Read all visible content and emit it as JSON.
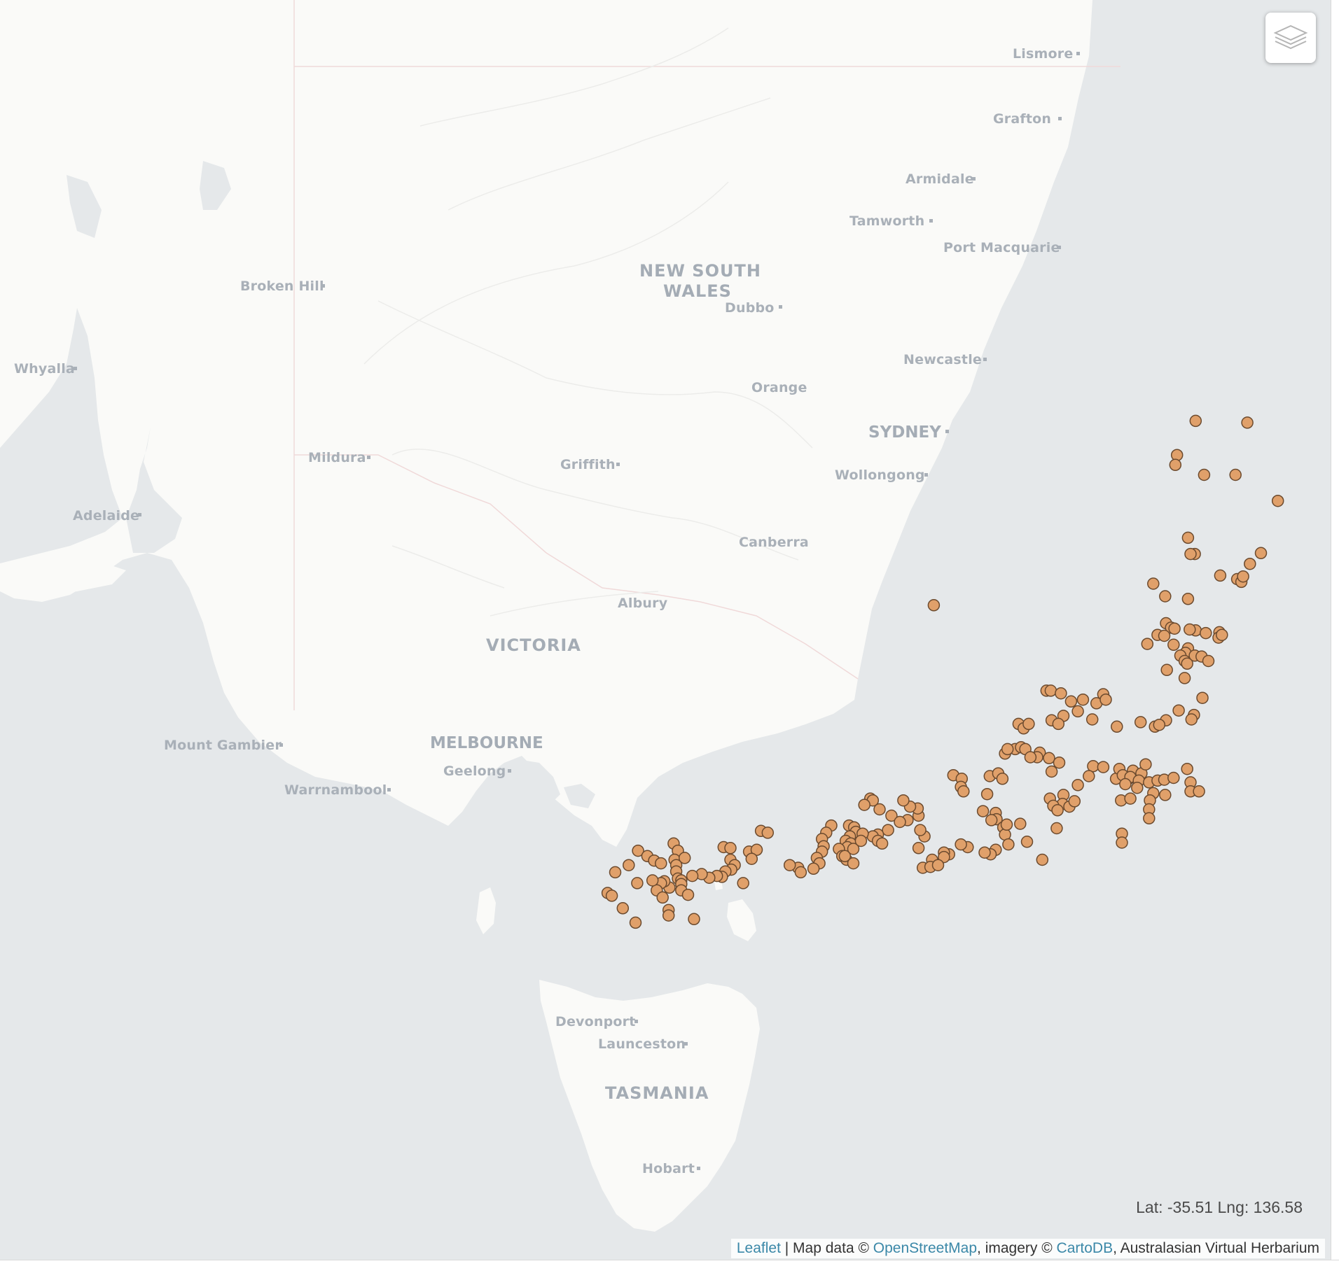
{
  "map": {
    "places": [
      {
        "name": "Lismore",
        "id": "lismore"
      },
      {
        "name": "Grafton",
        "id": "grafton"
      },
      {
        "name": "Armidale",
        "id": "armidale"
      },
      {
        "name": "Tamworth",
        "id": "tamworth"
      },
      {
        "name": "Port Macquarie",
        "id": "port-macquarie"
      },
      {
        "name": "Broken Hill",
        "id": "broken-hill"
      },
      {
        "name": "Dubbo",
        "id": "dubbo"
      },
      {
        "name": "Newcastle",
        "id": "newcastle"
      },
      {
        "name": "Whyalla",
        "id": "whyalla"
      },
      {
        "name": "Orange",
        "id": "orange"
      },
      {
        "name": "SYDNEY",
        "id": "sydney"
      },
      {
        "name": "Mildura",
        "id": "mildura"
      },
      {
        "name": "Griffith",
        "id": "griffith"
      },
      {
        "name": "Wollongong",
        "id": "wollongong"
      },
      {
        "name": "Adelaide",
        "id": "adelaide"
      },
      {
        "name": "Canberra",
        "id": "canberra"
      },
      {
        "name": "Albury",
        "id": "albury"
      },
      {
        "name": "Mount Gambier",
        "id": "mount-gambier"
      },
      {
        "name": "MELBOURNE",
        "id": "melbourne"
      },
      {
        "name": "Geelong",
        "id": "geelong"
      },
      {
        "name": "Warrnambool",
        "id": "warrnambool"
      },
      {
        "name": "Devonport",
        "id": "devonport"
      },
      {
        "name": "Launceston",
        "id": "launceston"
      },
      {
        "name": "Hobart",
        "id": "hobart"
      }
    ],
    "regions": [
      {
        "name": "NEW SOUTH",
        "id": "nsw-1"
      },
      {
        "name": "WALES",
        "id": "nsw-2"
      },
      {
        "name": "VICTORIA",
        "id": "victoria"
      },
      {
        "name": "TASMANIA",
        "id": "tasmania"
      }
    ],
    "marker_color": "#e0a06a",
    "marker_stroke": "#6b4a2e",
    "land_color": "#fafaf8",
    "water_color": "#e5e8ea",
    "occurrences": [
      [
        -31.42,
        152.78
      ],
      [
        -31.46,
        152.74
      ],
      [
        -31.5,
        152.7
      ],
      [
        -31.47,
        152.73
      ],
      [
        -32.98,
        150.69
      ],
      [
        -33.0,
        151.3
      ],
      [
        -33.36,
        150.47
      ],
      [
        -33.47,
        150.45
      ],
      [
        -33.58,
        150.79
      ],
      [
        -33.58,
        151.16
      ],
      [
        -33.87,
        151.66
      ],
      [
        -34.28,
        150.6
      ],
      [
        -34.46,
        150.68
      ],
      [
        -34.46,
        150.63
      ],
      [
        -34.45,
        151.46
      ],
      [
        -34.57,
        151.33
      ],
      [
        -34.7,
        150.98
      ],
      [
        -34.74,
        151.18
      ],
      [
        -34.77,
        151.23
      ],
      [
        -34.71,
        151.25
      ],
      [
        -34.79,
        150.19
      ],
      [
        -34.93,
        150.33
      ],
      [
        -35.03,
        147.6
      ],
      [
        -34.96,
        150.6
      ],
      [
        -35.23,
        150.34
      ],
      [
        -35.28,
        150.4
      ],
      [
        -35.29,
        150.44
      ],
      [
        -35.31,
        150.69
      ],
      [
        -35.34,
        150.81
      ],
      [
        -35.33,
        150.97
      ],
      [
        -35.39,
        150.96
      ],
      [
        -35.36,
        151.0
      ],
      [
        -35.36,
        150.24
      ],
      [
        -35.3,
        150.62
      ],
      [
        -35.37,
        150.32
      ],
      [
        -35.47,
        150.43
      ],
      [
        -35.46,
        150.12
      ],
      [
        -35.51,
        150.6
      ],
      [
        -35.56,
        150.57
      ],
      [
        -35.59,
        150.51
      ],
      [
        -35.59,
        150.68
      ],
      [
        -35.6,
        150.76
      ],
      [
        -35.65,
        150.84
      ],
      [
        -35.65,
        150.56
      ],
      [
        -35.68,
        150.59
      ],
      [
        -35.75,
        150.35
      ],
      [
        -35.84,
        150.56
      ],
      [
        -36.06,
        150.77
      ],
      [
        -36.2,
        150.49
      ],
      [
        -36.25,
        150.67
      ],
      [
        -36.31,
        150.34
      ],
      [
        -36.3,
        150.64
      ],
      [
        -36.38,
        150.21
      ],
      [
        -36.36,
        150.26
      ],
      [
        -36.33,
        150.04
      ],
      [
        -35.98,
        148.93
      ],
      [
        -35.98,
        148.98
      ],
      [
        -36.01,
        149.1
      ],
      [
        -36.1,
        149.22
      ],
      [
        -36.08,
        149.36
      ],
      [
        -36.12,
        149.52
      ],
      [
        -36.02,
        149.6
      ],
      [
        -36.08,
        149.63
      ],
      [
        -36.21,
        149.3
      ],
      [
        -36.26,
        149.13
      ],
      [
        -36.31,
        148.99
      ],
      [
        -36.35,
        149.07
      ],
      [
        -36.3,
        149.47
      ],
      [
        -36.38,
        149.76
      ],
      [
        -36.35,
        148.6
      ],
      [
        -36.4,
        148.66
      ],
      [
        -36.35,
        148.72
      ],
      [
        -36.63,
        148.56
      ],
      [
        -36.61,
        148.63
      ],
      [
        -36.63,
        148.68
      ],
      [
        -36.67,
        148.85
      ],
      [
        -36.72,
        148.82
      ],
      [
        -36.72,
        148.74
      ],
      [
        -36.68,
        148.44
      ],
      [
        -36.63,
        148.47
      ],
      [
        -36.73,
        148.96
      ],
      [
        -36.78,
        149.08
      ],
      [
        -36.88,
        148.99
      ],
      [
        -36.82,
        149.48
      ],
      [
        -36.83,
        149.6
      ],
      [
        -36.96,
        149.75
      ],
      [
        -36.87,
        149.95
      ],
      [
        -36.96,
        149.9
      ],
      [
        -36.9,
        150.05
      ],
      [
        -36.8,
        150.1
      ],
      [
        -36.85,
        149.79
      ],
      [
        -36.92,
        149.83
      ],
      [
        -36.94,
        149.92
      ],
      [
        -36.98,
        150.02
      ],
      [
        -37.0,
        150.14
      ],
      [
        -36.98,
        150.24
      ],
      [
        -36.97,
        150.32
      ],
      [
        -36.95,
        150.43
      ],
      [
        -36.85,
        150.59
      ],
      [
        -37.0,
        150.63
      ],
      [
        -37.1,
        150.63
      ],
      [
        -37.1,
        150.73
      ],
      [
        -37.14,
        150.33
      ],
      [
        -37.12,
        150.19
      ],
      [
        -37.06,
        150.0
      ],
      [
        -37.02,
        149.86
      ],
      [
        -37.2,
        149.81
      ],
      [
        -37.18,
        149.92
      ],
      [
        -37.2,
        150.15
      ],
      [
        -37.3,
        150.14
      ],
      [
        -37.4,
        150.14
      ],
      [
        -37.57,
        149.82
      ],
      [
        -37.67,
        149.82
      ],
      [
        -36.93,
        149.43
      ],
      [
        -37.03,
        149.3
      ],
      [
        -37.14,
        149.13
      ],
      [
        -37.24,
        149.12
      ],
      [
        -37.27,
        149.2
      ],
      [
        -37.21,
        149.26
      ],
      [
        -37.18,
        148.97
      ],
      [
        -37.26,
        149.01
      ],
      [
        -37.31,
        149.06
      ],
      [
        -37.51,
        149.05
      ],
      [
        -37.86,
        148.88
      ],
      [
        -36.93,
        148.26
      ],
      [
        -36.9,
        148.36
      ],
      [
        -36.96,
        148.41
      ],
      [
        -36.92,
        147.83
      ],
      [
        -36.96,
        147.93
      ],
      [
        -37.05,
        147.92
      ],
      [
        -37.1,
        147.95
      ],
      [
        -37.13,
        148.23
      ],
      [
        -37.32,
        148.18
      ],
      [
        -37.34,
        148.33
      ],
      [
        -37.41,
        148.34
      ],
      [
        -37.42,
        148.28
      ],
      [
        -37.5,
        148.42
      ],
      [
        -37.58,
        148.44
      ],
      [
        -37.47,
        148.46
      ],
      [
        -37.46,
        148.62
      ],
      [
        -37.66,
        148.7
      ],
      [
        -37.69,
        148.48
      ],
      [
        -37.75,
        148.33
      ],
      [
        -37.8,
        148.27
      ],
      [
        -37.78,
        148.2
      ],
      [
        -37.72,
        148.0
      ],
      [
        -37.69,
        147.92
      ],
      [
        -37.8,
        147.78
      ],
      [
        -37.78,
        147.72
      ],
      [
        -37.83,
        147.72
      ],
      [
        -37.86,
        147.58
      ],
      [
        -37.95,
        147.47
      ],
      [
        -37.94,
        147.56
      ],
      [
        -37.92,
        147.65
      ],
      [
        -37.73,
        147.42
      ],
      [
        -37.6,
        147.49
      ],
      [
        -37.53,
        147.44
      ],
      [
        -37.42,
        147.29
      ],
      [
        -37.37,
        147.42
      ],
      [
        -37.29,
        147.41
      ],
      [
        -37.27,
        147.32
      ],
      [
        -37.2,
        147.24
      ],
      [
        -37.18,
        146.85
      ],
      [
        -37.2,
        146.88
      ],
      [
        -37.25,
        146.78
      ],
      [
        -37.3,
        146.96
      ],
      [
        -37.37,
        147.1
      ],
      [
        -37.44,
        147.2
      ],
      [
        -37.53,
        147.06
      ],
      [
        -37.58,
        146.94
      ],
      [
        -37.6,
        146.88
      ],
      [
        -37.65,
        146.94
      ],
      [
        -37.68,
        146.99
      ],
      [
        -37.48,
        146.6
      ],
      [
        -37.5,
        146.66
      ],
      [
        -37.55,
        146.68
      ],
      [
        -37.57,
        146.76
      ],
      [
        -37.6,
        146.61
      ],
      [
        -37.65,
        146.56
      ],
      [
        -37.68,
        146.62
      ],
      [
        -37.72,
        146.58
      ],
      [
        -37.74,
        146.48
      ],
      [
        -37.82,
        146.52
      ],
      [
        -37.86,
        146.57
      ],
      [
        -37.48,
        146.39
      ],
      [
        -37.56,
        146.33
      ],
      [
        -37.63,
        146.28
      ],
      [
        -37.71,
        146.3
      ],
      [
        -37.77,
        146.28
      ],
      [
        -37.84,
        146.22
      ],
      [
        -37.9,
        146.25
      ],
      [
        -37.96,
        146.18
      ],
      [
        -37.82,
        146.55
      ],
      [
        -37.74,
        146.65
      ],
      [
        -37.65,
        146.74
      ],
      [
        -37.9,
        146.65
      ],
      [
        -37.95,
        146.0
      ],
      [
        -38.0,
        146.03
      ],
      [
        -37.92,
        145.9
      ],
      [
        -37.54,
        145.56
      ],
      [
        -37.56,
        145.64
      ],
      [
        -37.77,
        145.42
      ],
      [
        -37.72,
        145.12
      ],
      [
        -37.73,
        145.2
      ],
      [
        -37.75,
        145.51
      ],
      [
        -37.85,
        145.45
      ],
      [
        -37.86,
        145.2
      ],
      [
        -37.92,
        145.25
      ],
      [
        -37.97,
        145.21
      ],
      [
        -37.99,
        145.14
      ],
      [
        -38.05,
        145.1
      ],
      [
        -38.12,
        145.35
      ],
      [
        -38.04,
        145.04
      ],
      [
        -38.06,
        144.95
      ],
      [
        -37.68,
        144.53
      ],
      [
        -37.76,
        144.58
      ],
      [
        -37.86,
        144.54
      ],
      [
        -37.84,
        144.66
      ],
      [
        -37.92,
        144.56
      ],
      [
        -37.99,
        144.56
      ],
      [
        -38.07,
        144.58
      ],
      [
        -38.02,
        144.86
      ],
      [
        -38.04,
        144.75
      ],
      [
        -38.09,
        144.62
      ],
      [
        -38.13,
        144.62
      ],
      [
        -38.17,
        144.48
      ],
      [
        -38.2,
        144.62
      ],
      [
        -38.25,
        144.7
      ],
      [
        -38.1,
        144.42
      ],
      [
        -38.12,
        144.38
      ],
      [
        -38.2,
        144.33
      ],
      [
        -38.28,
        144.4
      ],
      [
        -37.76,
        144.11
      ],
      [
        -37.92,
        144.0
      ],
      [
        -38.0,
        143.84
      ],
      [
        -38.09,
        144.28
      ],
      [
        -38.12,
        144.1
      ],
      [
        -38.42,
        144.47
      ],
      [
        -38.48,
        144.47
      ],
      [
        -38.56,
        144.08
      ],
      [
        -38.52,
        144.77
      ],
      [
        -38.23,
        143.75
      ],
      [
        -38.26,
        143.8
      ],
      [
        -38.4,
        143.93
      ],
      [
        -37.82,
        144.22
      ],
      [
        -37.87,
        144.3
      ],
      [
        -37.9,
        144.38
      ]
    ]
  },
  "coords": {
    "label": "Lat: -35.51 Lng: 136.58"
  },
  "attribution": {
    "leaflet": "Leaflet",
    "sep1": " | Map data © ",
    "osm": "OpenStreetMap",
    "sep2": ", imagery © ",
    "carto": "CartoDB",
    "rest": ", Australasian Virtual Herbarium"
  },
  "controls": {
    "layers_icon": "layers-icon"
  }
}
